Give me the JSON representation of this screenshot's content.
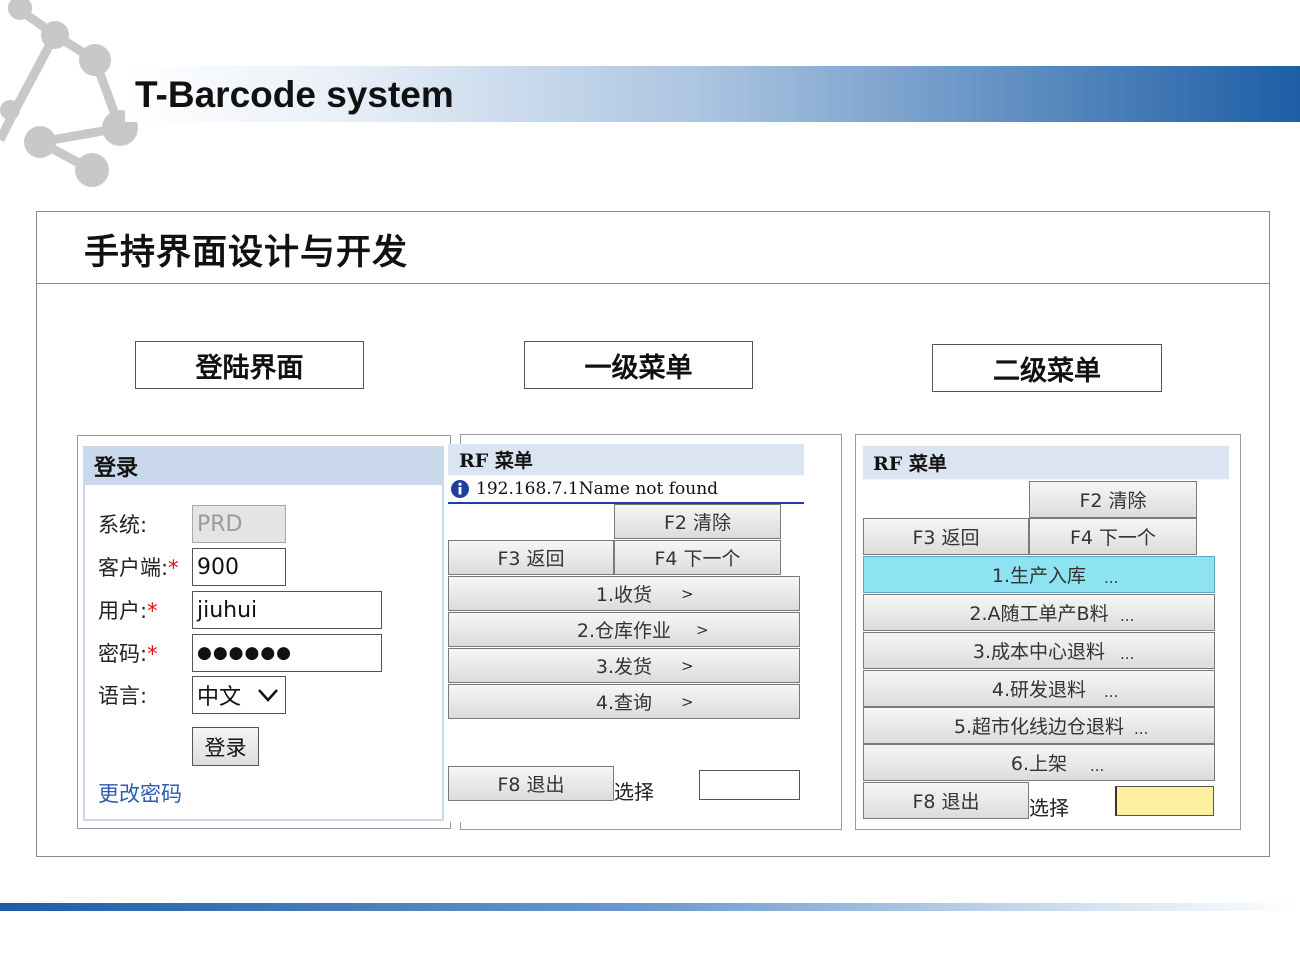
{
  "header": {
    "title": "T-Barcode system"
  },
  "section": {
    "title": "手持界面设计与开发"
  },
  "labels": {
    "login": "登陆界面",
    "menu1": "一级菜单",
    "menu2": "二级菜单"
  },
  "login_panel": {
    "title": "登录",
    "system_label": "系统:",
    "system_value": "PRD",
    "client_label": "客户端:",
    "client_value": "900",
    "user_label": "用户:",
    "user_value": "jiuhui",
    "password_label": "密码:",
    "password_value": "●●●●●●",
    "language_label": "语言:",
    "language_value": "中文",
    "required_mark": "*",
    "login_button": "登录",
    "change_password_link": "更改密码"
  },
  "menu1_panel": {
    "title": "RF 菜单",
    "info_message": "192.168.7.1Name not found",
    "f2": "F2 清除",
    "f3": "F3 返回",
    "f4": "F4 下一个",
    "items": [
      {
        "label": "1.收货",
        "arrow": ">"
      },
      {
        "label": "2.仓库作业",
        "arrow": ">"
      },
      {
        "label": "3.发货",
        "arrow": ">"
      },
      {
        "label": "4.查询",
        "arrow": ">"
      }
    ],
    "f8": "F8 退出",
    "select_label": "选择"
  },
  "menu2_panel": {
    "title": "RF 菜单",
    "f2": "F2 清除",
    "f3": "F3 返回",
    "f4": "F4 下一个",
    "items": [
      {
        "label": "1.生产入库",
        "more": "..."
      },
      {
        "label": "2.A随工单产B料",
        "more": "..."
      },
      {
        "label": "3.成本中心退料",
        "more": "..."
      },
      {
        "label": "4.研发退料",
        "more": "..."
      },
      {
        "label": "5.超市化线边仓退料",
        "more": "..."
      },
      {
        "label": "6.上架",
        "more": "..."
      }
    ],
    "f8": "F8 退出",
    "select_label": "选择"
  },
  "colors": {
    "header_blue": "#1d5ea5",
    "titlebar": "#c9d8ea",
    "highlight": "#8de3f1",
    "required": "#e01010",
    "link": "#2a5db0",
    "input_yellow": "#fff0a0"
  }
}
